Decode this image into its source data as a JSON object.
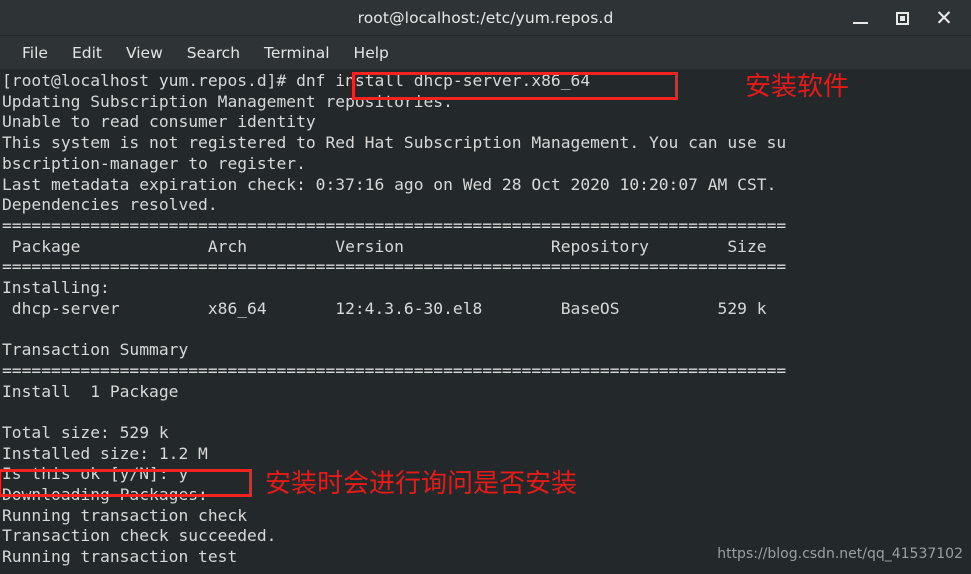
{
  "window": {
    "title": "root@localhost:/etc/yum.repos.d",
    "controls": [
      {
        "name": "minimize",
        "glyph": "_"
      },
      {
        "name": "maximize",
        "glyph": "□"
      },
      {
        "name": "close",
        "glyph": "×"
      }
    ]
  },
  "menubar": {
    "items": [
      "File",
      "Edit",
      "View",
      "Search",
      "Terminal",
      "Help"
    ]
  },
  "terminal": {
    "prompt": "[root@localhost yum.repos.d]# ",
    "command": "dnf install dhcp-server.x86_64",
    "lines": [
      "[root@localhost yum.repos.d]# dnf install dhcp-server.x86_64",
      "Updating Subscription Management repositories.",
      "Unable to read consumer identity",
      "This system is not registered to Red Hat Subscription Management. You can use su",
      "bscription-manager to register.",
      "Last metadata expiration check: 0:37:16 ago on Wed 28 Oct 2020 10:20:07 AM CST.",
      "Dependencies resolved.",
      "================================================================================",
      " Package             Arch         Version               Repository        Size",
      "================================================================================",
      "Installing:",
      " dhcp-server         x86_64       12:4.3.6-30.el8        BaseOS          529 k",
      "",
      "Transaction Summary",
      "================================================================================",
      "Install  1 Package",
      "",
      "Total size: 529 k",
      "Installed size: 1.2 M",
      "Is this ok [y/N]: y",
      "Downloading Packages:",
      "Running transaction check",
      "Transaction check succeeded.",
      "Running transaction test"
    ],
    "table": {
      "headers": [
        "Package",
        "Arch",
        "Version",
        "Repository",
        "Size"
      ],
      "rows": [
        [
          "dhcp-server",
          "x86_64",
          "12:4.3.6-30.el8",
          "BaseOS",
          "529 k"
        ]
      ]
    },
    "summary": {
      "install_count": "Install  1 Package",
      "total_size": "Total size: 529 k",
      "installed_size": "Installed size: 1.2 M",
      "confirm_prompt": "Is this ok [y/N]: y",
      "answer": "y"
    }
  },
  "annotations": {
    "install_note": "安装软件",
    "confirm_note": "安装时会进行询问是否安装",
    "color": "#e81a17"
  },
  "watermark": "https://blog.csdn.net/qq_41537102"
}
